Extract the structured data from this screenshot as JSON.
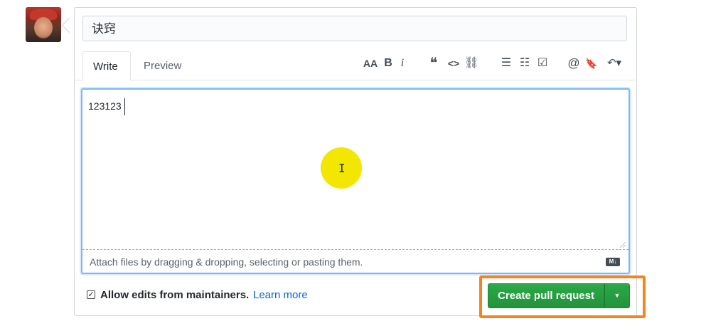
{
  "title_value": "诀窍",
  "tabs": {
    "write": "Write",
    "preview": "Preview"
  },
  "toolbar": {
    "header": "AA",
    "bold": "B",
    "italic": "i",
    "quote": "❝",
    "code": "<>",
    "link": "⛓",
    "ul": "☰",
    "ol": "☷",
    "tasklist": "☑",
    "mention": "@",
    "bookmark": "🔖",
    "reply": "↶▾"
  },
  "editor": {
    "value": "123123",
    "drop_hint": "Attach files by dragging & dropping, selecting or pasting them.",
    "md_badge": "M↓"
  },
  "footer": {
    "checkbox_mark": "✓",
    "allow_label": "Allow edits from maintainers.",
    "learn_more": "Learn more",
    "create_label": "Create pull request",
    "dropdown_caret": "▼"
  },
  "colors": {
    "accent_green": "#28a745",
    "focus_blue": "#79b8ff",
    "link_blue": "#0366d6",
    "highlight_orange": "#f5841f",
    "cursor_yellow": "#f3e600"
  }
}
